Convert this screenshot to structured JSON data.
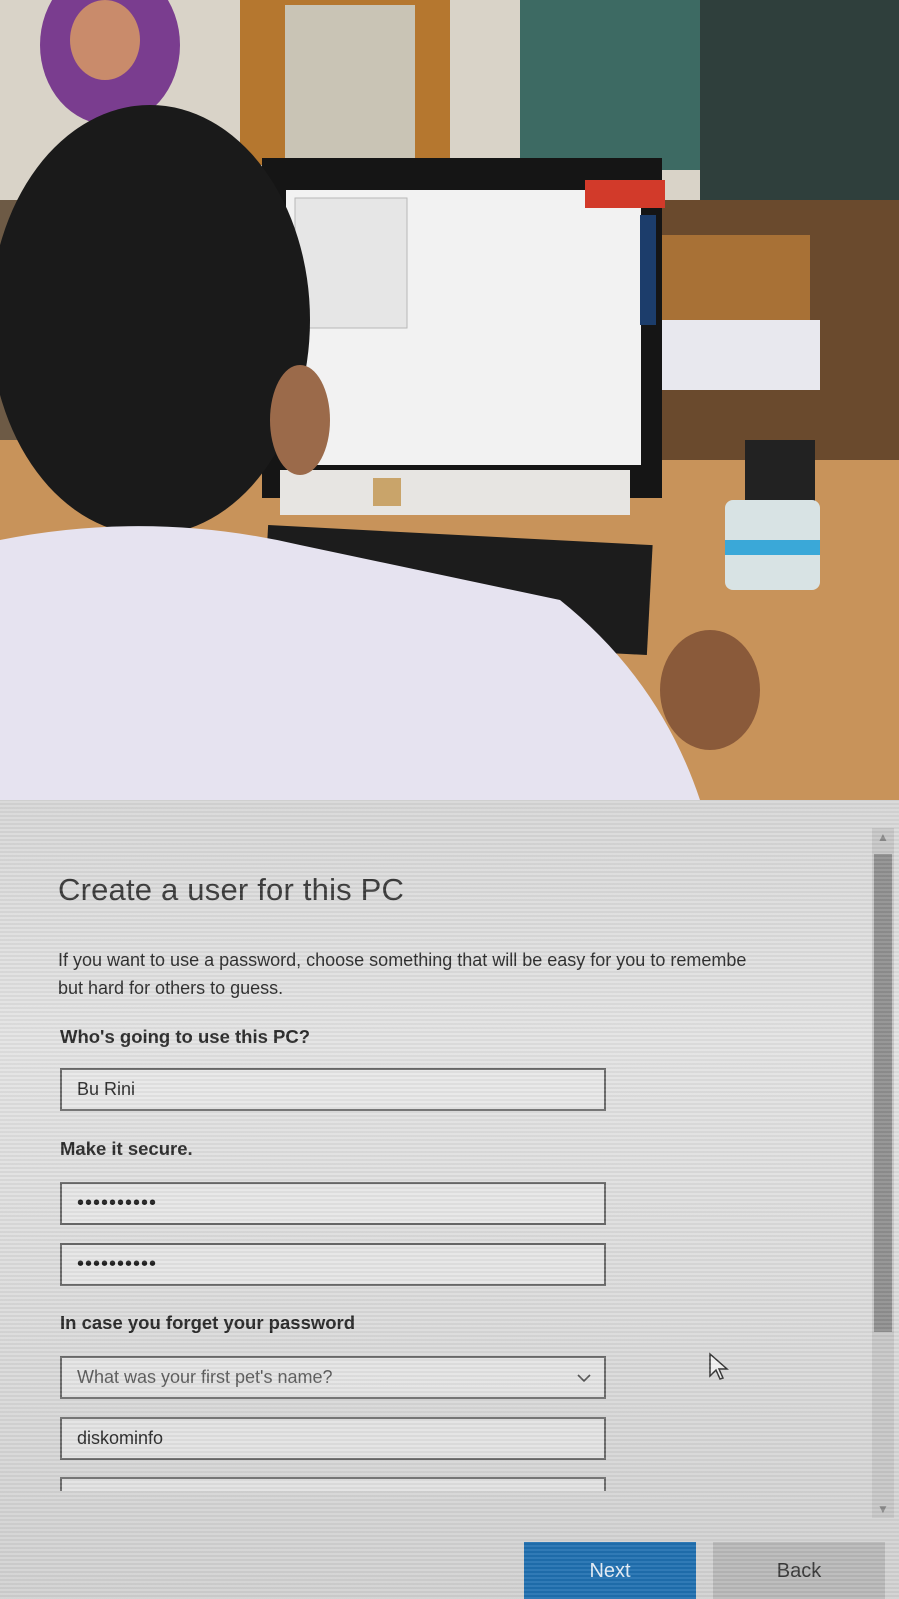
{
  "dialog": {
    "title": "Create a user for this PC",
    "description_line1": "If you want to use a password, choose something that will be easy for you to remembe",
    "description_line2": "but hard for others to guess.",
    "user_section_label": "Who's going to use this PC?",
    "username_value": "Bu Rini",
    "password_section_label": "Make it secure.",
    "password_value": "••••••••••",
    "password_confirm_value": "••••••••••",
    "recovery_section_label": "In case you forget your password",
    "security_question_selected": "What was your first pet's name?",
    "security_answer_value": "diskominfo"
  },
  "buttons": {
    "next_label": "Next",
    "back_label": "Back"
  },
  "icons": {
    "dropdown": "chevron-down-icon",
    "scroll_up": "scroll-up-arrow-icon",
    "scroll_down": "scroll-down-arrow-icon",
    "cursor": "mouse-pointer-icon"
  },
  "colors": {
    "accent": "#1f6fb0",
    "background": "#dcdcdc",
    "text": "#2e2e2e"
  }
}
